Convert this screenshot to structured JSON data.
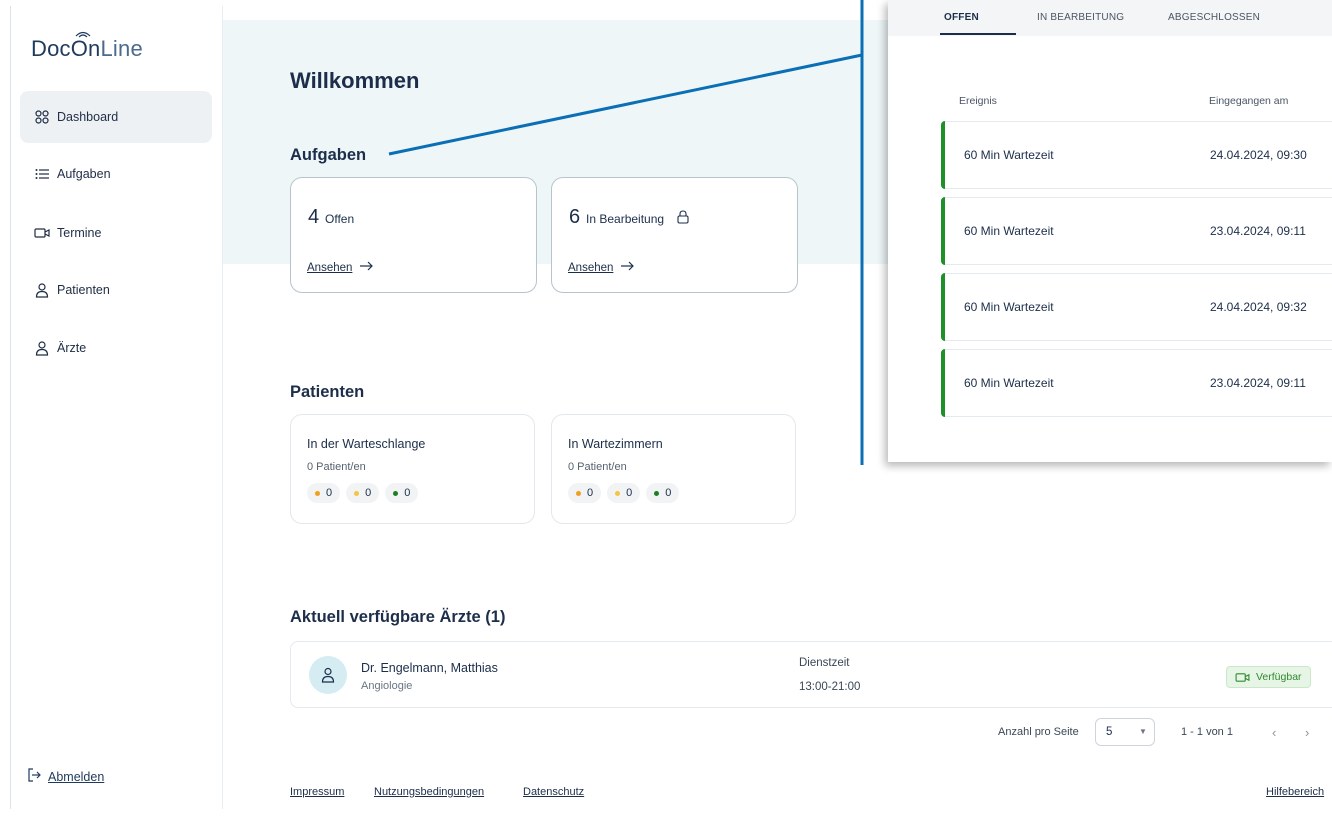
{
  "app": {
    "logo_part1": "DocOn",
    "logo_part2": "Line"
  },
  "sidebar": {
    "items": [
      {
        "label": "Dashboard",
        "icon": "grid-icon",
        "active": true
      },
      {
        "label": "Aufgaben",
        "icon": "list-icon"
      },
      {
        "label": "Termine",
        "icon": "video-icon"
      },
      {
        "label": "Patienten",
        "icon": "person-icon"
      },
      {
        "label": "Ärzte",
        "icon": "person-icon"
      }
    ],
    "logout_label": "Abmelden"
  },
  "main": {
    "welcome": "Willkommen",
    "tasks": {
      "title": "Aufgaben",
      "cards": [
        {
          "count": "4",
          "label": "Offen",
          "link": "Ansehen"
        },
        {
          "count": "6",
          "label": "In Bearbeitung",
          "link": "Ansehen",
          "locked": true
        }
      ]
    },
    "patients": {
      "title": "Patienten",
      "cards": [
        {
          "title": "In der Warteschlange",
          "subtitle": "0 Patient/en",
          "counts": [
            "0",
            "0",
            "0"
          ]
        },
        {
          "title": "In Wartezimmern",
          "subtitle": "0 Patient/en",
          "counts": [
            "0",
            "0",
            "0"
          ]
        }
      ],
      "dot_colors": [
        "#f0a020",
        "#f5c542",
        "#1e7e24"
      ]
    },
    "doctors": {
      "title": "Aktuell verfügbare Ärzte (1)",
      "rows": [
        {
          "name": "Dr. Engelmann, Matthias",
          "specialty": "Angiologie",
          "duty_label": "Dienstzeit",
          "duty_time": "13:00-21:00",
          "status": "Verfügbar"
        }
      ]
    },
    "pagination": {
      "per_page_label": "Anzahl pro Seite",
      "per_page_value": "5",
      "range": "1 - 1 von 1"
    },
    "footer": {
      "links": [
        "Impressum",
        "Nutzungsbedingungen",
        "Datenschutz"
      ],
      "help": "Hilfebereich"
    }
  },
  "overlay": {
    "tabs": [
      "OFFEN",
      "IN BEARBEITUNG",
      "ABGESCHLOSSEN"
    ],
    "active_tab": "OFFEN",
    "columns": [
      "Ereignis",
      "Eingegangen am"
    ],
    "rows": [
      {
        "event": "60 Min Wartezeit",
        "received": "24.04.2024, 09:30"
      },
      {
        "event": "60 Min Wartezeit",
        "received": "23.04.2024, 09:11"
      },
      {
        "event": "60 Min Wartezeit",
        "received": "24.04.2024, 09:32"
      },
      {
        "event": "60 Min Wartezeit",
        "received": "23.04.2024, 09:11"
      }
    ]
  },
  "colors": {
    "accent_line": "#0a6fb5",
    "status_green": "#1f8f2a",
    "hero_bg": "#eef6f8"
  }
}
